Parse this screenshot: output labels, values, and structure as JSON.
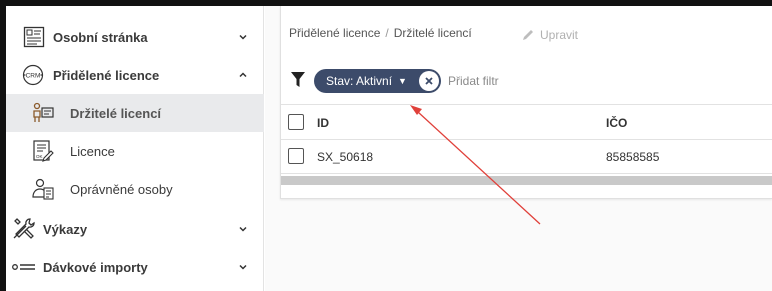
{
  "sidebar": {
    "items": [
      {
        "label": "Osobní stránka",
        "icon": "profile-page-icon",
        "expanded": false
      },
      {
        "label": "Přidělené licence",
        "icon": "crm-icon",
        "expanded": true
      },
      {
        "label": "Držitelé licencí",
        "icon": "license-holders-icon",
        "active": true
      },
      {
        "label": "Licence",
        "icon": "license-document-icon"
      },
      {
        "label": "Oprávněné osoby",
        "icon": "authorized-persons-icon"
      },
      {
        "label": "Výkazy",
        "icon": "tools-icon",
        "expanded": false
      },
      {
        "label": "Dávkové importy",
        "icon": "list-icon",
        "expanded": false
      }
    ]
  },
  "breadcrumb": {
    "parent": "Přidělené licence",
    "separator": "/",
    "current": "Držitelé licencí"
  },
  "toolbar": {
    "edit_label": "Upravit"
  },
  "filters": {
    "active_chip": "Stav: Aktivní",
    "add_label": "Přidat filtr"
  },
  "table": {
    "columns": [
      "ID",
      "IČO"
    ],
    "rows": [
      [
        "SX_50618",
        "85858585"
      ]
    ]
  },
  "colors": {
    "chip_bg": "#3c4b6a",
    "active_nav_bg": "#e9eaec",
    "annotation_arrow": "#e0403a"
  }
}
